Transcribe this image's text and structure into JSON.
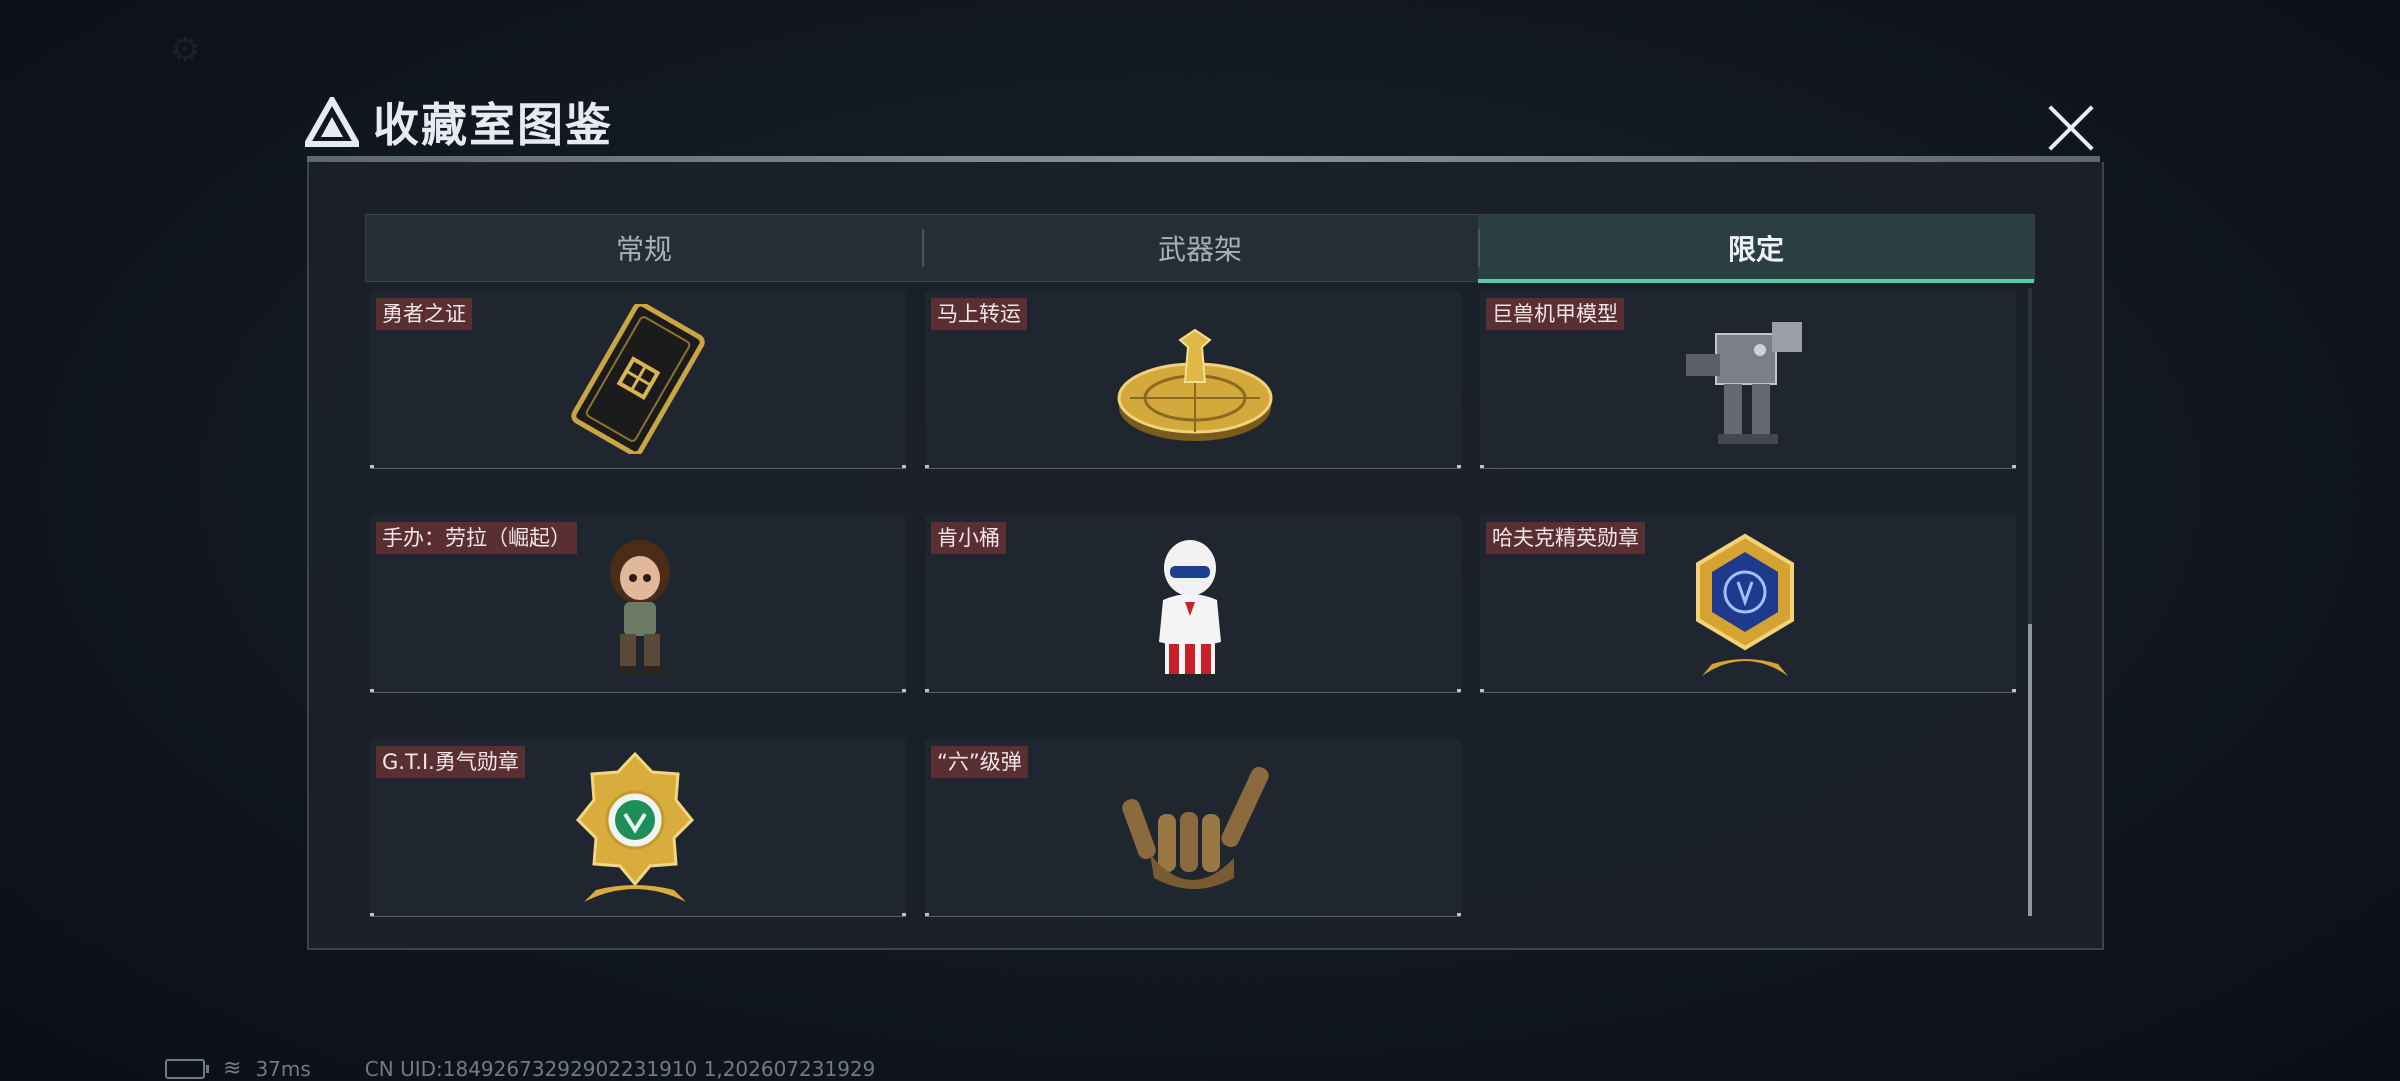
{
  "title": "收藏室图鉴",
  "tabs": [
    {
      "label": "常规",
      "active": false
    },
    {
      "label": "武器架",
      "active": false
    },
    {
      "label": "限定",
      "active": true
    }
  ],
  "items": [
    {
      "label": "勇者之证",
      "icon": "gold-card-icon"
    },
    {
      "label": "马上转运",
      "icon": "fortune-wheel-icon"
    },
    {
      "label": "巨兽机甲模型",
      "icon": "mech-model-icon"
    },
    {
      "label": "手办：劳拉（崛起）",
      "icon": "lara-figure-icon"
    },
    {
      "label": "肯小桶",
      "icon": "kfc-figure-icon"
    },
    {
      "label": "哈夫克精英勋章",
      "icon": "haavk-medal-icon"
    },
    {
      "label": "G.T.I.勇气勋章",
      "icon": "gti-medal-icon"
    },
    {
      "label": "“六”级弹",
      "icon": "bullet-hand-icon"
    }
  ],
  "status": {
    "ping": "37ms",
    "uid": "CN UID:18492673292902231910 1,202607231929"
  },
  "colors": {
    "accent": "#5fc9a8",
    "label_bg": "#5a2f33",
    "panel": "#1b2129"
  }
}
